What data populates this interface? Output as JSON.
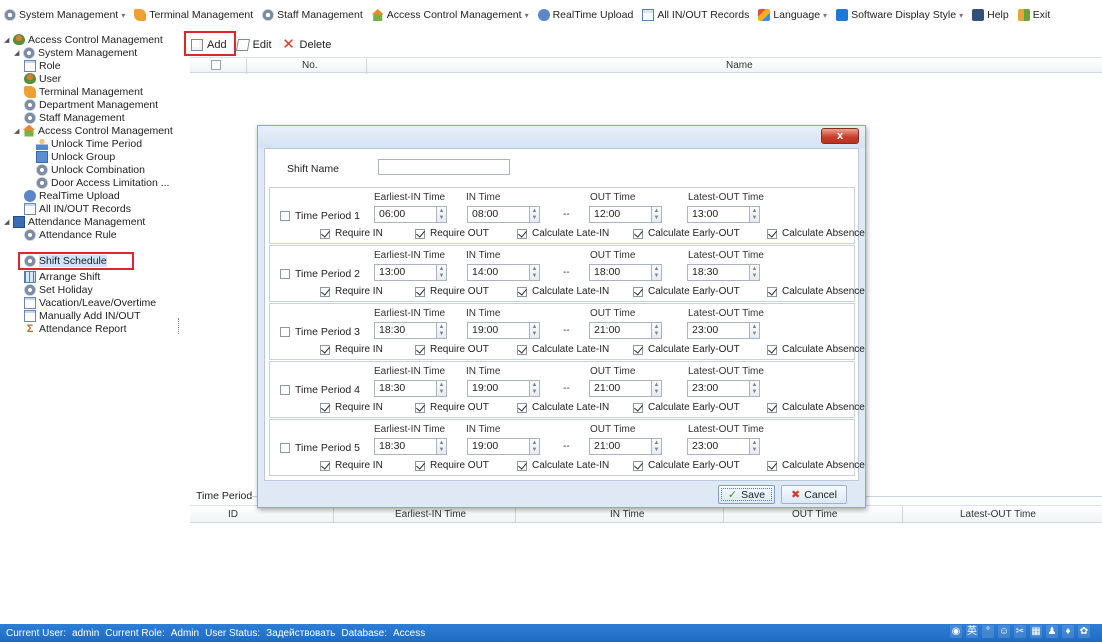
{
  "menubar": {
    "items": [
      {
        "label": "System Management",
        "icon": "gear-icon",
        "dropdown": true
      },
      {
        "label": "Terminal Management",
        "icon": "terminal-icon",
        "dropdown": false
      },
      {
        "label": "Staff Management",
        "icon": "gear-icon",
        "dropdown": false
      },
      {
        "label": "Access Control Management",
        "icon": "house-icon",
        "dropdown": true
      },
      {
        "label": "RealTime Upload",
        "icon": "upload-icon",
        "dropdown": false
      },
      {
        "label": "All IN/OUT Records",
        "icon": "records-icon",
        "dropdown": false
      },
      {
        "label": "Language",
        "icon": "language-icon",
        "dropdown": true
      },
      {
        "label": "Software Display Style",
        "icon": "display-style-icon",
        "dropdown": true
      },
      {
        "label": "Help",
        "icon": "help-icon",
        "dropdown": false
      },
      {
        "label": "Exit",
        "icon": "exit-icon",
        "dropdown": false
      }
    ]
  },
  "sidebar": {
    "items": [
      {
        "label": "Access Control Management",
        "icon": "user-group-icon",
        "expanded": true
      },
      {
        "label": "System Management",
        "icon": "gear-icon",
        "expanded": true
      },
      {
        "label": "Role",
        "icon": "document-icon"
      },
      {
        "label": "User",
        "icon": "user-icon"
      },
      {
        "label": "Terminal Management",
        "icon": "terminal-icon"
      },
      {
        "label": "Department Management",
        "icon": "gear-icon"
      },
      {
        "label": "Staff Management",
        "icon": "gear-icon"
      },
      {
        "label": "Access Control Management",
        "icon": "house-icon",
        "expanded": true
      },
      {
        "label": "Unlock Time Period",
        "icon": "person-icon"
      },
      {
        "label": "Unlock Group",
        "icon": "group-icon"
      },
      {
        "label": "Unlock Combination",
        "icon": "gear-icon"
      },
      {
        "label": "Door Access Limitation ...",
        "icon": "gear-icon"
      },
      {
        "label": "RealTime Upload",
        "icon": "upload-icon"
      },
      {
        "label": "All IN/OUT Records",
        "icon": "records-icon"
      },
      {
        "label": "Attendance Management",
        "icon": "attendance-icon",
        "expanded": true
      },
      {
        "label": "Attendance Rule",
        "icon": "gear-icon"
      },
      {
        "label": "Shift Schedule",
        "icon": "gear-icon",
        "selected": true
      },
      {
        "label": "Arrange Shift",
        "icon": "grid-icon"
      },
      {
        "label": "Set Holiday",
        "icon": "gear-icon"
      },
      {
        "label": "Vacation/Leave/Overtime",
        "icon": "records-icon"
      },
      {
        "label": "Manually Add IN/OUT",
        "icon": "records-icon"
      },
      {
        "label": "Attendance Report",
        "icon": "sigma-icon"
      }
    ]
  },
  "toolbar": {
    "add_label": "Add",
    "edit_label": "Edit",
    "delete_label": "Delete"
  },
  "main_grid": {
    "columns": [
      "No.",
      "Name"
    ]
  },
  "time_period_panel": {
    "title": "Time Period",
    "columns": [
      "ID",
      "Earliest-IN Time",
      "IN Time",
      "OUT Time",
      "Latest-OUT Time"
    ]
  },
  "dialog": {
    "close_label": "x",
    "shift_name_label": "Shift Name",
    "shift_name_value": "",
    "column_headers": {
      "earliest_in": "Earliest-IN Time",
      "in": "IN Time",
      "out": "OUT Time",
      "latest_out": "Latest-OUT Time"
    },
    "separator": "--",
    "flag_labels": {
      "require_in": "Require IN",
      "require_out": "Require OUT",
      "calc_late_in": "Calculate Late-IN",
      "calc_early_out": "Calculate Early-OUT",
      "calc_absence": "Calculate Absence"
    },
    "periods": [
      {
        "label": "Time Period 1",
        "enabled": false,
        "earliest_in": "06:00",
        "in": "08:00",
        "out": "12:00",
        "latest_out": "13:00",
        "require_in": true,
        "require_out": true,
        "calc_late_in": true,
        "calc_early_out": true,
        "calc_absence": true
      },
      {
        "label": "Time Period 2",
        "enabled": false,
        "earliest_in": "13:00",
        "in": "14:00",
        "out": "18:00",
        "latest_out": "18:30",
        "require_in": true,
        "require_out": true,
        "calc_late_in": true,
        "calc_early_out": true,
        "calc_absence": true
      },
      {
        "label": "Time Period 3",
        "enabled": false,
        "earliest_in": "18:30",
        "in": "19:00",
        "out": "21:00",
        "latest_out": "23:00",
        "require_in": true,
        "require_out": true,
        "calc_late_in": true,
        "calc_early_out": true,
        "calc_absence": true
      },
      {
        "label": "Time Period 4",
        "enabled": false,
        "earliest_in": "18:30",
        "in": "19:00",
        "out": "21:00",
        "latest_out": "23:00",
        "require_in": true,
        "require_out": true,
        "calc_late_in": true,
        "calc_early_out": true,
        "calc_absence": true
      },
      {
        "label": "Time Period 5",
        "enabled": false,
        "earliest_in": "18:30",
        "in": "19:00",
        "out": "21:00",
        "latest_out": "23:00",
        "require_in": true,
        "require_out": true,
        "calc_late_in": true,
        "calc_early_out": true,
        "calc_absence": true
      }
    ],
    "save_label": "Save",
    "cancel_label": "Cancel"
  },
  "statusbar": {
    "current_user_label": "Current User:",
    "current_user": "admin",
    "current_role_label": "Current Role:",
    "current_role": "Admin",
    "user_status_label": "User Status:",
    "user_status": "Задействовать",
    "database_label": "Database:",
    "database": "Access",
    "tray_icons": [
      "input-method-icon",
      "chinese-ime-icon",
      "punctuation-icon",
      "emoji-icon",
      "tools-icon",
      "keyboard-icon",
      "user-icon",
      "shirt-icon",
      "settings-icon"
    ]
  },
  "colors": {
    "status_bar": "#1f6bc4",
    "highlight_box": "#e0262a",
    "dialog_frame": "#dfe9f5",
    "close_button": "#c9402b",
    "selected_tree_item": "#cfe3fb"
  }
}
